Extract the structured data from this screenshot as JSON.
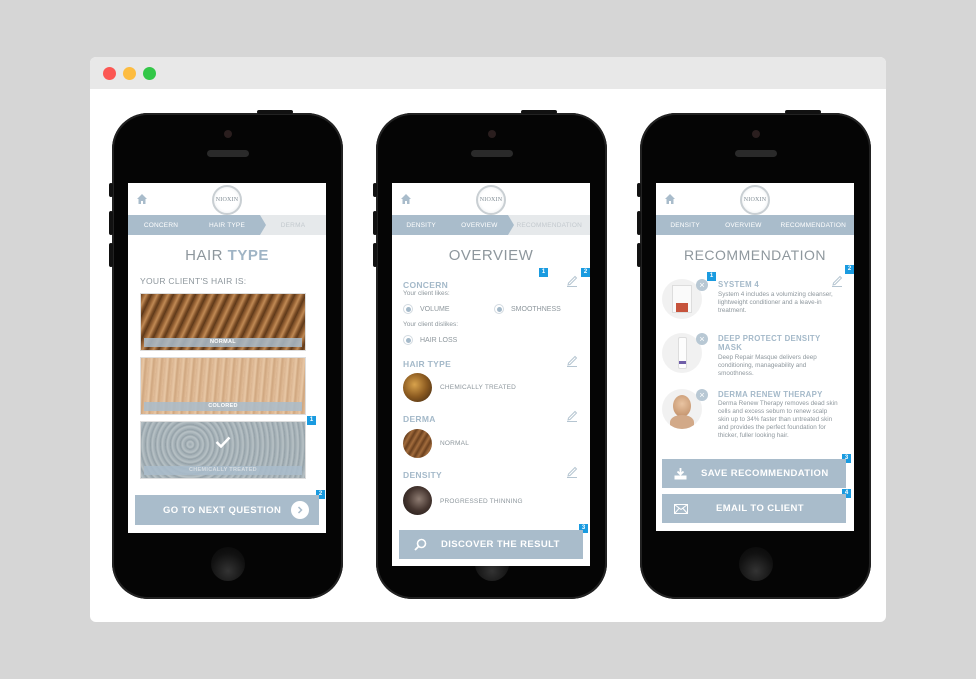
{
  "window": {
    "controls": [
      "close",
      "minimize",
      "zoom"
    ]
  },
  "brand": {
    "logo_text": "NIOXIN",
    "accent": "#a9bccb",
    "badge_color": "#1a9be0"
  },
  "screen1": {
    "breadcrumb": [
      "CONCERN",
      "HAIR TYPE",
      "DERMA"
    ],
    "title_light": "HAIR ",
    "title_bold": "TYPE",
    "subhead": "YOUR CLIENT'S HAIR IS:",
    "options": [
      {
        "label": "NORMAL",
        "selected": false
      },
      {
        "label": "COLORED",
        "selected": false
      },
      {
        "label": "CHEMICALLY TREATED",
        "selected": true
      }
    ],
    "next_button": "GO TO NEXT QUESTION",
    "badges": [
      "1",
      "2"
    ]
  },
  "screen2": {
    "breadcrumb": [
      "DENSITY",
      "OVERVIEW",
      "RECOMMENDATION"
    ],
    "title": "OVERVIEW",
    "concern": {
      "heading": "CONCERN",
      "likes_label": "Your client likes:",
      "likes": [
        "VOLUME",
        "SMOOTHNESS"
      ],
      "dislikes_label": "Your client dislikes:",
      "dislikes": [
        "HAIR LOSS"
      ]
    },
    "sections": [
      {
        "heading": "HAIR TYPE",
        "value": "CHEMICALLY TREATED"
      },
      {
        "heading": "DERMA",
        "value": "NORMAL"
      },
      {
        "heading": "DENSITY",
        "value": "PROGRESSED THINNING"
      }
    ],
    "discover_button": "DISCOVER THE RESULT",
    "badges": [
      "1",
      "2",
      "3"
    ]
  },
  "screen3": {
    "breadcrumb": [
      "DENSITY",
      "OVERVIEW",
      "RECOMMENDATION"
    ],
    "title": "RECOMMENDATION",
    "products": [
      {
        "name": "SYSTEM 4",
        "description": "System 4 includes a volumizing cleanser, lightweight conditioner and a leave-in treatment."
      },
      {
        "name": "DEEP PROTECT DENSITY MASK",
        "description": "Deep Repair Masque delivers deep conditioning, manageability and smoothness."
      },
      {
        "name": "DERMA RENEW THERAPY",
        "description": "Derma Renew Therapy removes dead skin cells and excess sebum to renew scalp skin up to 34% faster than untreated skin and provides the perfect foundation for thicker, fuller looking hair."
      }
    ],
    "save_button": "SAVE RECOMMENDATION",
    "email_button": "EMAIL TO CLIENT",
    "badges": [
      "1",
      "2",
      "3",
      "4"
    ]
  }
}
